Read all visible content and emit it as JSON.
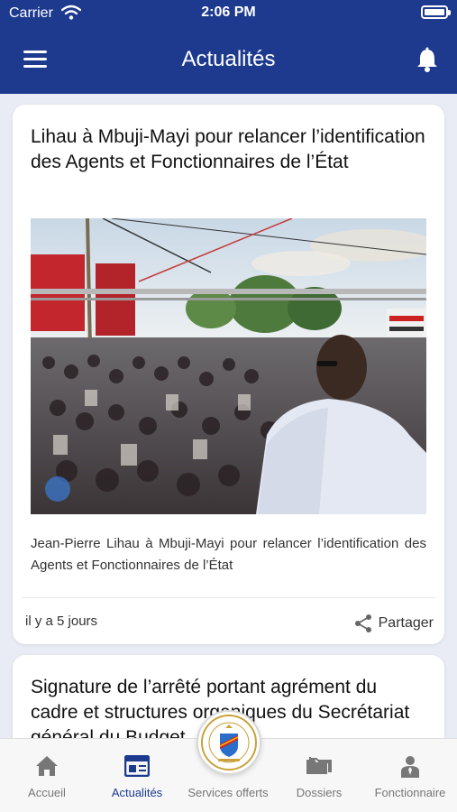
{
  "status_bar": {
    "carrier": "Carrier",
    "time": "2:06 PM"
  },
  "header": {
    "title": "Actualités",
    "menu_icon": "hamburger-icon",
    "notification_icon": "bell-icon"
  },
  "articles": [
    {
      "title": "Lihau à Mbuji-Mayi pour relancer l’identification des Agents et Fonctionnaires de l’État",
      "description": "Jean-Pierre Lihau à Mbuji-Mayi pour relancer l’identification des Agents et Fonctionnaires de l’État",
      "date": "il y a 5 jours",
      "share_label": "Partager"
    },
    {
      "title": "Signature de l’arrêté portant agrément du cadre et structures organiques du Secrétariat général du Budget"
    }
  ],
  "tabbar": {
    "tabs": [
      {
        "label": "Accueil",
        "icon": "home-icon"
      },
      {
        "label": "Actualités",
        "icon": "news-icon",
        "active": true
      },
      {
        "label": "Services offerts",
        "icon": "government-emblem-icon"
      },
      {
        "label": "Dossiers",
        "icon": "folders-icon"
      },
      {
        "label": "Fonctionnaire",
        "icon": "person-icon"
      }
    ]
  },
  "colors": {
    "primary": "#1d3a8f",
    "background": "#e9ebf5",
    "tab_inactive": "#777777"
  }
}
